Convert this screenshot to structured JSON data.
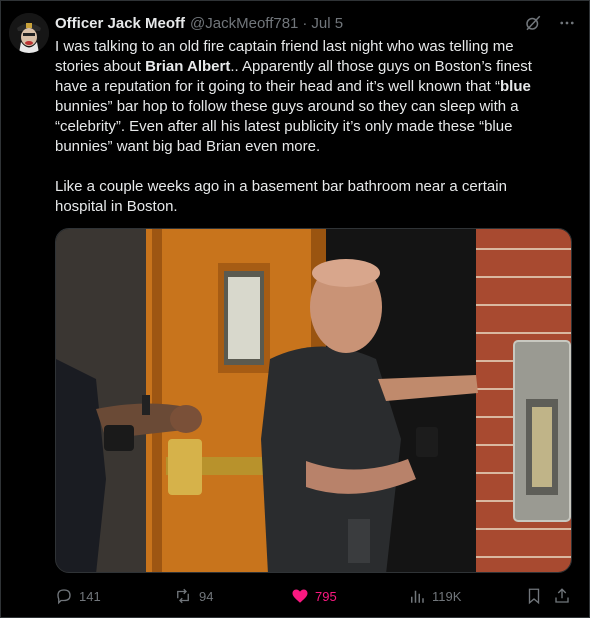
{
  "author": {
    "name": "Officer Jack Meoff",
    "handle": "@JackMeoff781",
    "separator": "·",
    "date": "Jul 5"
  },
  "tweet": {
    "p1_a": "I was talking to an old fire captain friend last night who was telling me stories about ",
    "p1_bold1": "Brian Albert",
    "p1_b": ".. Apparently all those guys on Boston’s finest have a reputation for it going to their head and it’s well known that “",
    "p1_bold2": "blue",
    "p1_c": "\nbunnies” bar hop to follow these guys around so they can sleep with a “celebrity”. Even after all his latest publicity it’s only made these “blue bunnies” want big bad Brian even more.",
    "p2": "\n\nLike a couple weeks ago in a basement bar bathroom near a certain hospital in Boston."
  },
  "actions": {
    "replies": "141",
    "reposts": "94",
    "likes": "795",
    "views": "119K"
  },
  "icons": {
    "header": [
      "grok-slash-icon",
      "more-icon"
    ],
    "actions": [
      "reply-icon",
      "repost-icon",
      "like-icon",
      "views-icon",
      "bookmark-icon",
      "share-icon"
    ]
  },
  "colors": {
    "background": "#000000",
    "text": "#e7e9ea",
    "secondary": "#71767b",
    "like": "#f91880"
  }
}
